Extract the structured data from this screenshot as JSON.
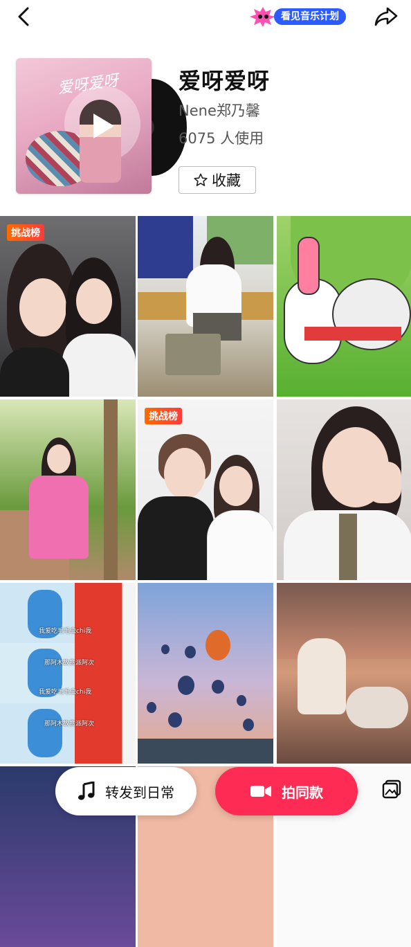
{
  "top_bar": {
    "back_icon": "chevron-left-icon",
    "plan_label": "看见音乐计划",
    "share_icon": "share-arrow-icon",
    "accent": "#2c5cff"
  },
  "song": {
    "title": "爱呀爱呀",
    "artist": "Nene郑乃馨",
    "usage": "6075 人使用",
    "favorite_label": "收藏",
    "cover_text": "爱呀爱呀"
  },
  "grid": {
    "tiles": [
      {
        "badge": "挑战榜"
      },
      {
        "badge": ""
      },
      {
        "badge": ""
      },
      {
        "badge": ""
      },
      {
        "badge": "挑战榜"
      },
      {
        "badge": ""
      },
      {
        "badge": ""
      },
      {
        "badge": ""
      },
      {
        "badge": ""
      }
    ],
    "captions": [
      "我爱吃毛毛虫chi我",
      "那阿木故意派阿次",
      "我爱吃毛毛虫chi我",
      "那阿木故意派阿次"
    ]
  },
  "actions": {
    "repost_label": "转发到日常",
    "shoot_label": "拍同款",
    "shoot_color": "#fe2c55"
  }
}
